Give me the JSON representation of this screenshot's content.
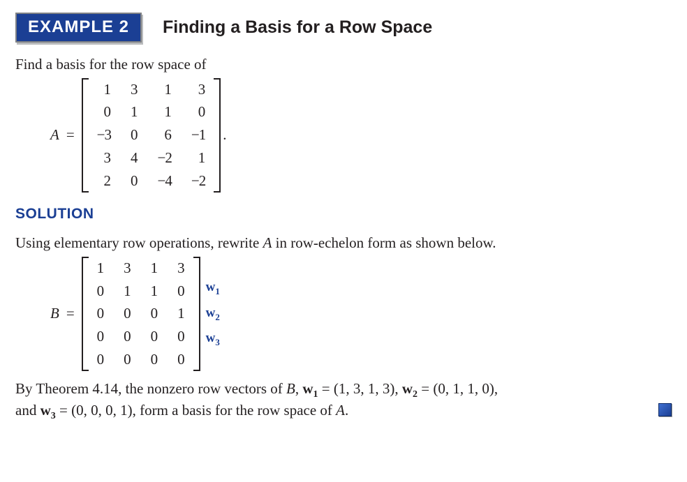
{
  "header": {
    "badge": "EXAMPLE 2",
    "title": "Finding a Basis for a Row Space"
  },
  "find_line": "Find a basis for the row space of",
  "matrixA": {
    "label": "A",
    "eq": "=",
    "rows": [
      [
        "1",
        "3",
        "1",
        "3"
      ],
      [
        "0",
        "1",
        "1",
        "0"
      ],
      [
        "−3",
        "0",
        "6",
        "−1"
      ],
      [
        "3",
        "4",
        "−2",
        "1"
      ],
      [
        "2",
        "0",
        "−4",
        "−2"
      ]
    ],
    "trailing": "."
  },
  "solution_head": "SOLUTION",
  "solution_line_pre": "Using elementary row operations, rewrite ",
  "solution_line_mid": " in row-echelon form as shown below.",
  "matrixB": {
    "label": "B",
    "eq": "=",
    "rows": [
      [
        "1",
        "3",
        "1",
        "3"
      ],
      [
        "0",
        "1",
        "1",
        "0"
      ],
      [
        "0",
        "0",
        "0",
        "1"
      ],
      [
        "0",
        "0",
        "0",
        "0"
      ],
      [
        "0",
        "0",
        "0",
        "0"
      ]
    ],
    "row_labels": [
      "w",
      "w",
      "w"
    ],
    "row_label_subs": [
      "1",
      "2",
      "3"
    ]
  },
  "conclusion": {
    "p1": "By Theorem 4.14, the nonzero row vectors of ",
    "B": "B",
    "comma_sp": ", ",
    "w1": "w",
    "s1": "1",
    "eq": " = ",
    "v1": "(1, 3, 1, 3)",
    "w2": "w",
    "s2": "2",
    "v2": "(0, 1, 1, 0)",
    "and": "and ",
    "w3": "w",
    "s3": "3",
    "v3": "(0, 0, 0, 1)",
    "p2": ", form a basis for the row space of ",
    "A": "A",
    "dot": "."
  }
}
